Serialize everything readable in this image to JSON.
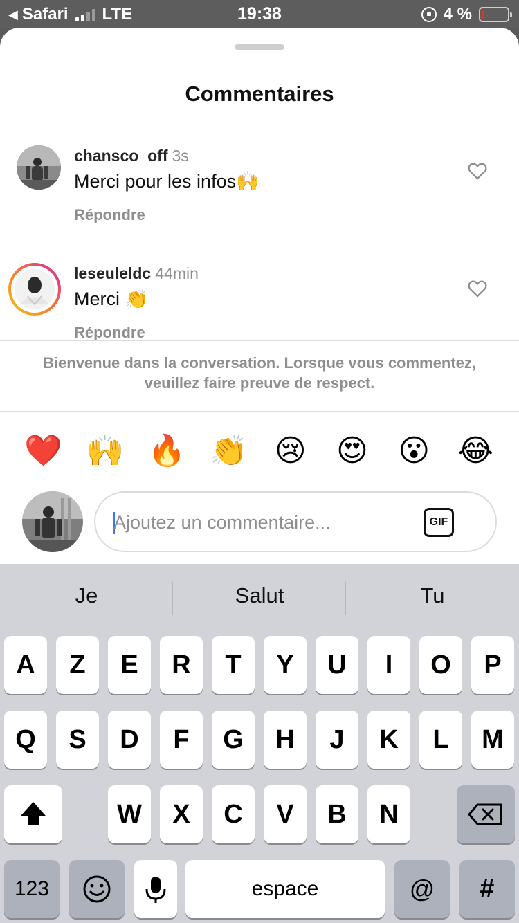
{
  "status_bar": {
    "back_app": "Safari",
    "carrier": "LTE",
    "time": "19:38",
    "battery_percent": "4 %",
    "battery_level": 0.04,
    "signal_bars_active": 2
  },
  "sheet": {
    "title": "Commentaires",
    "comments": [
      {
        "username": "chansco_off",
        "time": "3s",
        "text": "Merci pour les infos🙌",
        "reply_label": "Répondre",
        "avatar_icon": "profile-photo",
        "has_story_ring": false
      },
      {
        "username": "leseuleldc",
        "time": "44min",
        "text": "Merci 👏",
        "reply_label": "Répondre",
        "avatar_icon": "profile-photo",
        "has_story_ring": true
      }
    ],
    "welcome_text": "Bienvenue dans la conversation. Lorsque vous commentez, veuillez faire preuve de respect.",
    "quick_emojis": [
      "❤️",
      "🙌",
      "🔥",
      "👏",
      "😢",
      "😍",
      "😮",
      "😂"
    ],
    "composer": {
      "placeholder": "Ajoutez un commentaire...",
      "value": "",
      "gif_label": "GIF"
    }
  },
  "keyboard": {
    "suggestions": [
      "Je",
      "Salut",
      "Tu"
    ],
    "row1": [
      "A",
      "Z",
      "E",
      "R",
      "T",
      "Y",
      "U",
      "I",
      "O",
      "P"
    ],
    "row2": [
      "Q",
      "S",
      "D",
      "F",
      "G",
      "H",
      "J",
      "K",
      "L",
      "M"
    ],
    "row3": [
      "W",
      "X",
      "C",
      "V",
      "B",
      "N"
    ],
    "numbers_label": "123",
    "space_label": "espace",
    "at_label": "@",
    "hash_label": "#"
  },
  "colors": {
    "accent_blue": "#3478f6",
    "battery_low": "#e0302a",
    "muted_text": "#8e8e8e",
    "story_ring_start": "#f5c518",
    "story_ring_end": "#d6249f"
  }
}
